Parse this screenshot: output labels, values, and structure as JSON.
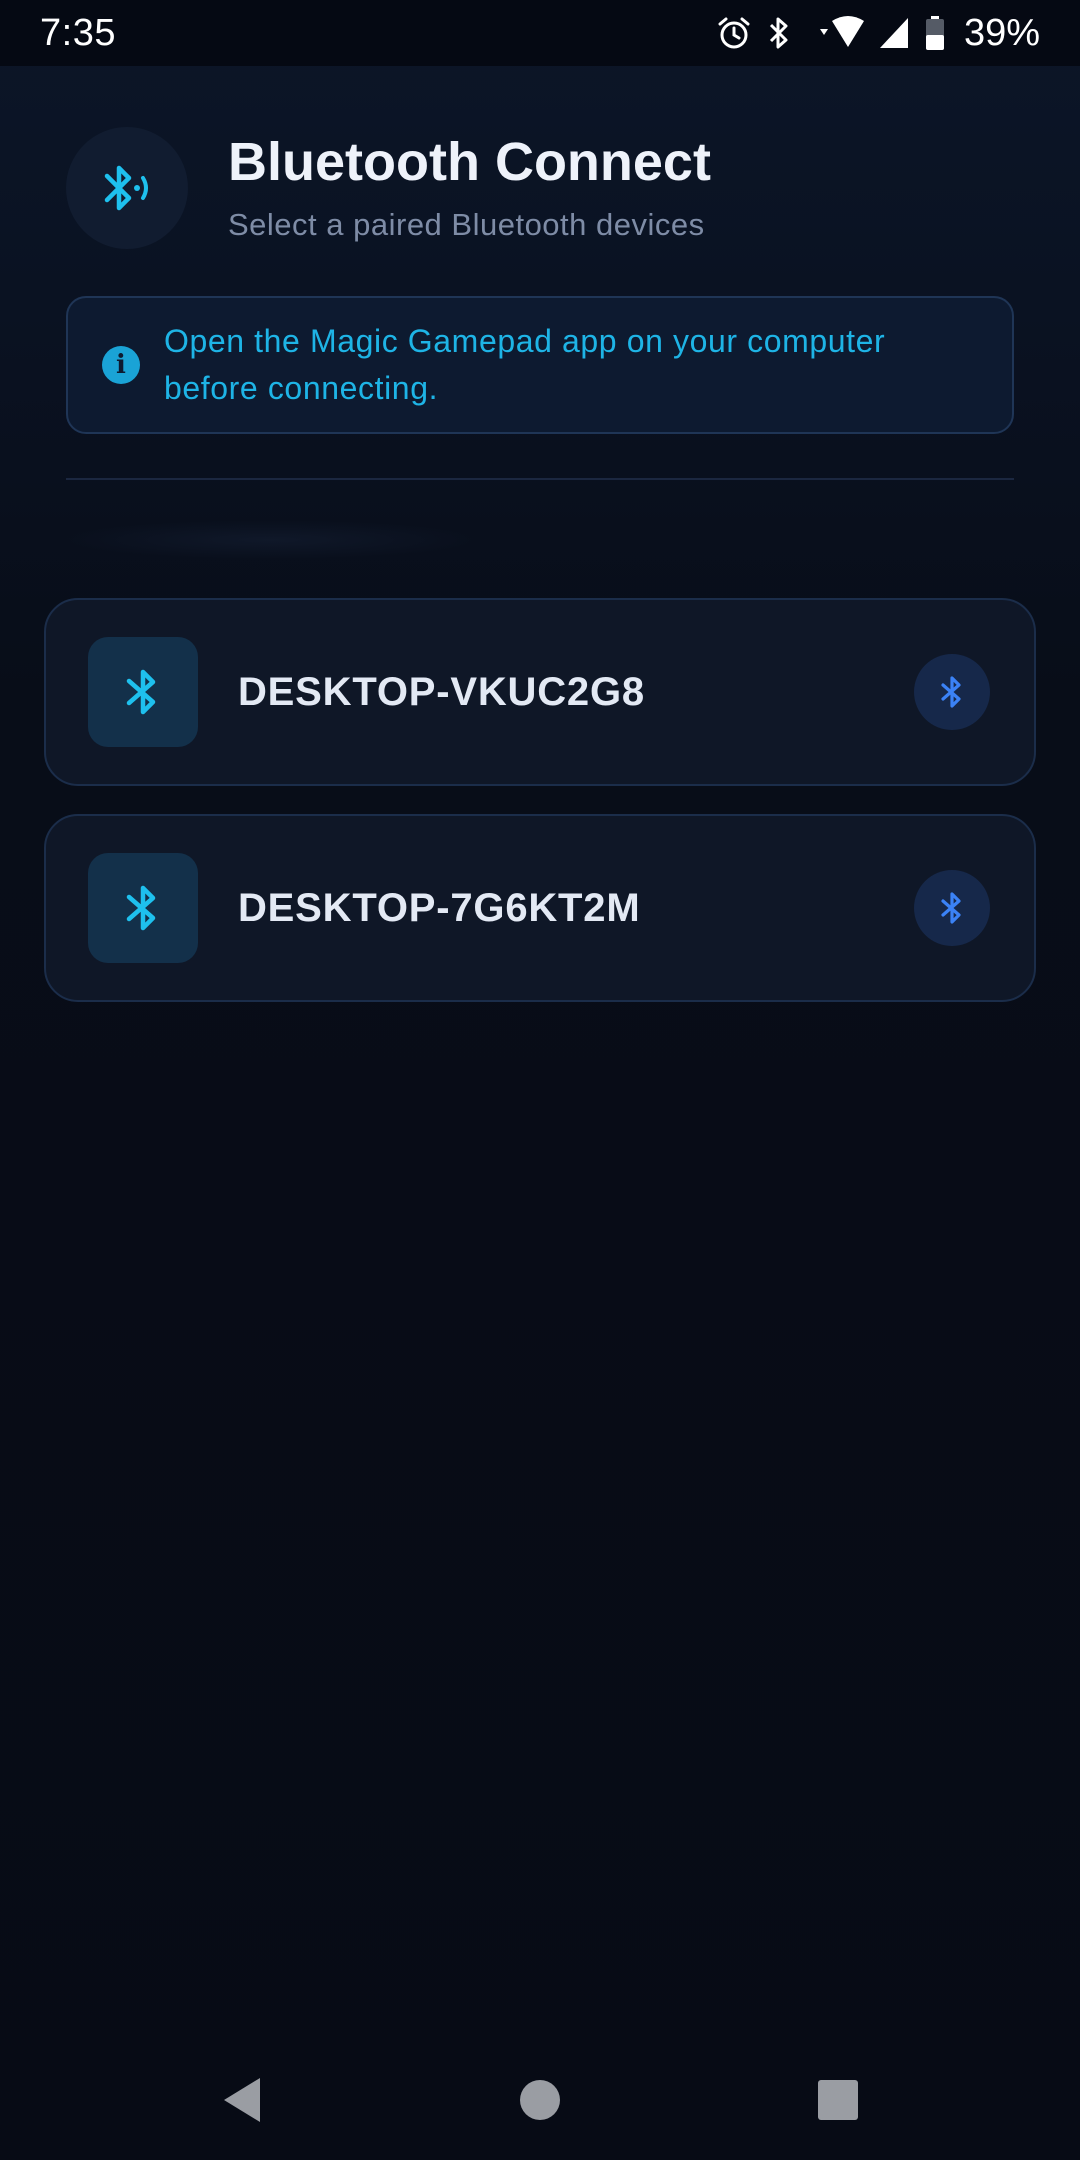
{
  "status_bar": {
    "time": "7:35",
    "battery": "39%",
    "icons": [
      "alarm-icon",
      "bluetooth-icon",
      "wifi-icon",
      "signal-icon",
      "battery-icon"
    ]
  },
  "header": {
    "title": "Bluetooth Connect",
    "subtitle": "Select a paired Bluetooth devices",
    "icon": "bluetooth-searching-icon"
  },
  "info_banner": {
    "icon": "info-icon",
    "icon_glyph": "i",
    "text_line1": "Open the Magic Gamepad app on your computer",
    "text_line2": "before connecting."
  },
  "devices": [
    {
      "name": "DESKTOP-VKUC2G8",
      "icon": "bluetooth-icon",
      "action_icon": "bluetooth-icon"
    },
    {
      "name": "DESKTOP-7G6KT2M",
      "icon": "bluetooth-icon",
      "action_icon": "bluetooth-icon"
    }
  ],
  "nav_bar": {
    "buttons": [
      "back-icon",
      "home-icon",
      "recents-icon"
    ]
  },
  "colors": {
    "accent": "#1eb4e6",
    "background": "#080d18",
    "card": "#0f1727",
    "card_border": "#1b2d4a",
    "action_icon": "#3b82f6"
  }
}
